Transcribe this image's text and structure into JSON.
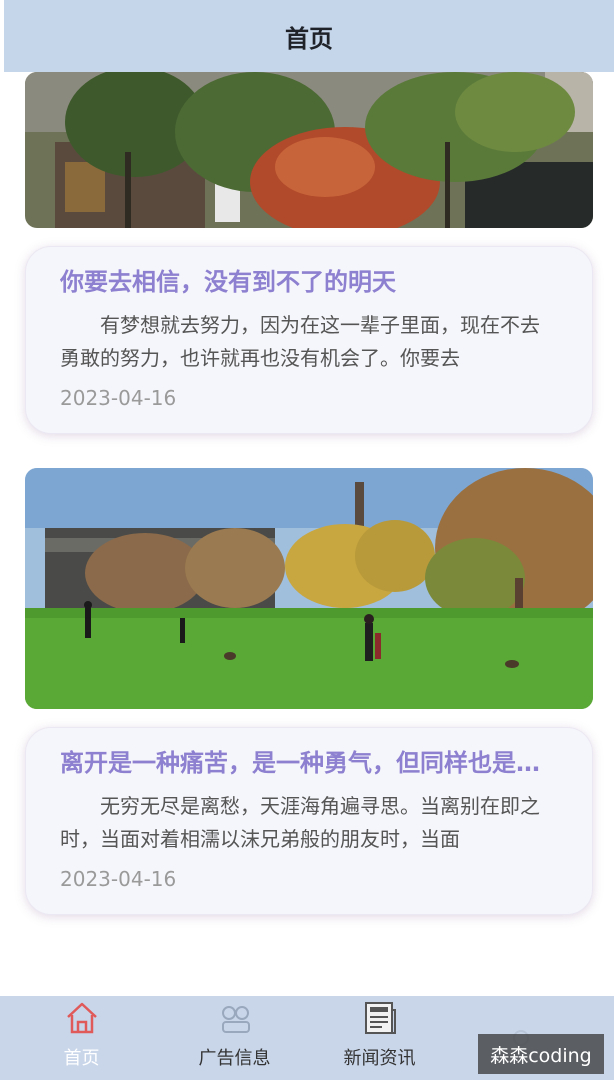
{
  "header": {
    "title": "首页"
  },
  "articles": [
    {
      "title": "你要去相信，没有到不了的明天",
      "description": "有梦想就去努力，因为在这一辈子里面，现在不去勇敢的努力，也许就再也没有机会了。你要去",
      "date": "2023-04-16"
    },
    {
      "title": "离开是一种痛苦，是一种勇气，但同样也是一种力量",
      "description": "无穷无尽是离愁，天涯海角遍寻思。当离别在即之时，当面对着相濡以沫兄弟般的朋友时，当面",
      "date": "2023-04-16"
    }
  ],
  "tabbar": {
    "items": [
      {
        "label": "首页",
        "icon": "home-icon",
        "active": true
      },
      {
        "label": "广告信息",
        "icon": "ad-icon",
        "active": false
      },
      {
        "label": "新闻资讯",
        "icon": "news-icon",
        "active": false
      },
      {
        "label": "",
        "icon": "user-icon",
        "active": false
      }
    ],
    "active_color": "#e05a5a"
  },
  "watermark": "森森coding"
}
